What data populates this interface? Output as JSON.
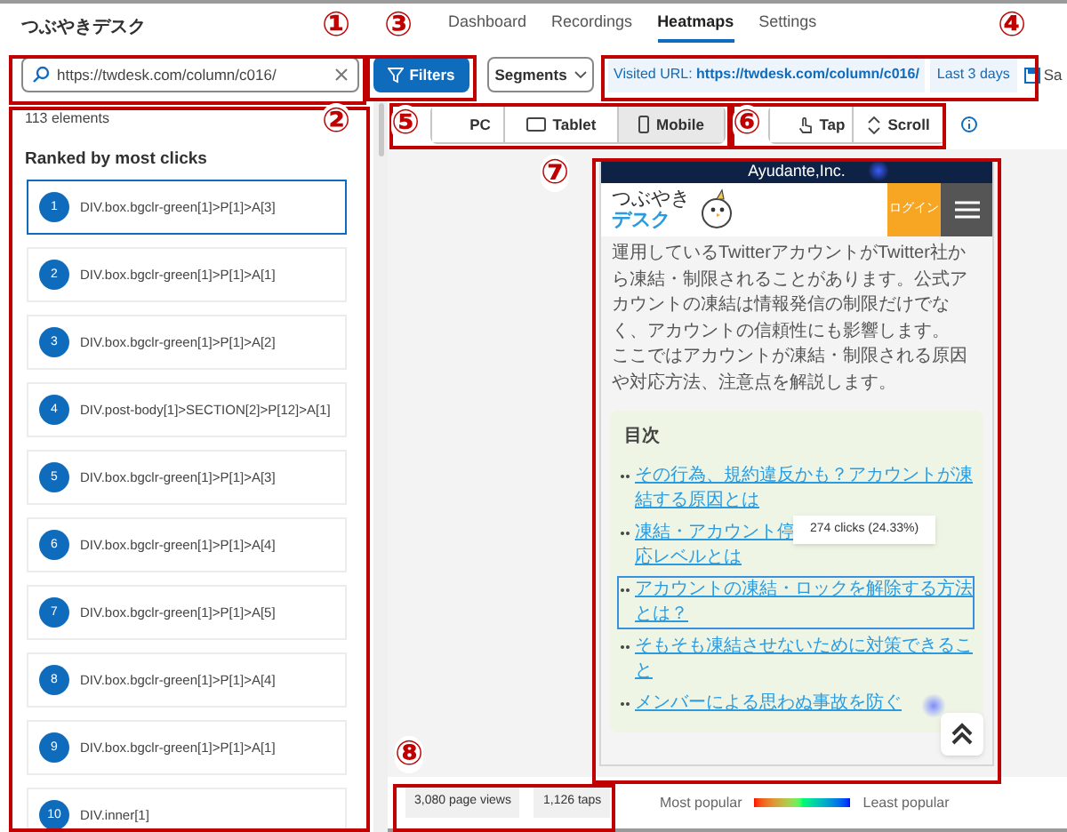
{
  "app": {
    "title": "つぶやきデスク"
  },
  "nav": [
    {
      "label": "Dashboard",
      "selected": false
    },
    {
      "label": "Recordings",
      "selected": false
    },
    {
      "label": "Heatmaps",
      "selected": true
    },
    {
      "label": "Settings",
      "selected": false
    }
  ],
  "search": {
    "value": "https://twdesk.com/column/c016/"
  },
  "filters_button": "Filters",
  "segments_dropdown": "Segments",
  "visited_url": {
    "label": "Visited URL:",
    "value": "https://twdesk.com/column/c016/"
  },
  "date_range": "Last 3 days",
  "save_button": "Sa",
  "element_count": "113 elements",
  "ranking_title": "Ranked by most clicks",
  "elements": [
    {
      "rank": "1",
      "selector": "DIV.box.bgclr-green[1]>P[1]>A[3]",
      "selected": true
    },
    {
      "rank": "2",
      "selector": "DIV.box.bgclr-green[1]>P[1]>A[1]",
      "selected": false
    },
    {
      "rank": "3",
      "selector": "DIV.box.bgclr-green[1]>P[1]>A[2]",
      "selected": false
    },
    {
      "rank": "4",
      "selector": "DIV.post-body[1]>SECTION[2]>P[12]>A[1]",
      "selected": false
    },
    {
      "rank": "5",
      "selector": "DIV.box.bgclr-green[1]>P[1]>A[3]",
      "selected": false
    },
    {
      "rank": "6",
      "selector": "DIV.box.bgclr-green[1]>P[1]>A[4]",
      "selected": false
    },
    {
      "rank": "7",
      "selector": "DIV.box.bgclr-green[1]>P[1]>A[5]",
      "selected": false
    },
    {
      "rank": "8",
      "selector": "DIV.box.bgclr-green[1]>P[1]>A[4]",
      "selected": false
    },
    {
      "rank": "9",
      "selector": "DIV.box.bgclr-green[1]>P[1]>A[1]",
      "selected": false
    },
    {
      "rank": "10",
      "selector": "DIV.inner[1]",
      "selected": false
    }
  ],
  "device_tabs": [
    {
      "label": "PC",
      "kind": "pc",
      "selected": false
    },
    {
      "label": "Tablet",
      "kind": "tablet",
      "selected": false
    },
    {
      "label": "Mobile",
      "kind": "mobile",
      "selected": true
    }
  ],
  "mode_tabs": [
    {
      "label": "Tap",
      "kind": "tap",
      "selected": false
    },
    {
      "label": "Scroll",
      "kind": "scroll",
      "selected": false
    }
  ],
  "preview": {
    "banner": "Ayudante,Inc.",
    "logo_top": "つぶやき",
    "logo_bottom": "デスク",
    "login_button": "ログイン",
    "intro": [
      "運用しているTwitterアカウントがTwitter社から凍結・制限されることがあります。公式アカウントの凍結は情報発信の制限だけでなく、アカウントの信頼性にも影響します。",
      "ここではアカウントが凍結・制限される原因や対応方法、注意点を解説します。"
    ],
    "toc_title": "目次",
    "toc": [
      {
        "lines": [
          "その行為、規約違反かも？アカウントが凍",
          "結する原因とは"
        ],
        "highlighted": false
      },
      {
        "lines": [
          "凍結・アカウント停",
          "応レベルとは"
        ],
        "highlighted": false
      },
      {
        "lines": [
          "アカウントの凍結・ロックを解除する方法",
          "とは？"
        ],
        "highlighted": true
      },
      {
        "lines": [
          "そもそも凍結させないために対策できるこ",
          "と"
        ],
        "highlighted": false
      },
      {
        "lines": [
          "メンバーによる思わぬ事故を防ぐ"
        ],
        "highlighted": false
      }
    ],
    "tooltip": "274 clicks (24.33%)"
  },
  "stats": [
    "3,080 page views",
    "1,126 taps"
  ],
  "legend": {
    "most": "Most popular",
    "least": "Least popular"
  },
  "callouts": [
    "①",
    "②",
    "③",
    "④",
    "⑤",
    "⑥",
    "⑦",
    "⑧"
  ]
}
